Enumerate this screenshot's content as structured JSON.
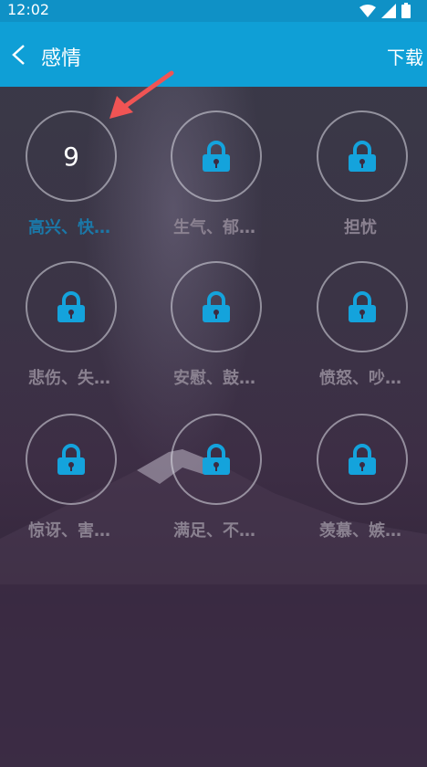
{
  "status_bar": {
    "time": "12:02"
  },
  "app_bar": {
    "title": "感情",
    "action": "下载"
  },
  "items": [
    {
      "label": "高兴、快…",
      "count": "9",
      "locked": false,
      "active": true
    },
    {
      "label": "生气、郁…",
      "locked": true
    },
    {
      "label": "担忧",
      "locked": true
    },
    {
      "label": "悲伤、失…",
      "locked": true
    },
    {
      "label": "安慰、鼓…",
      "locked": true
    },
    {
      "label": "愤怒、吵…",
      "locked": true
    },
    {
      "label": "惊讶、害…",
      "locked": true
    },
    {
      "label": "满足、不…",
      "locked": true
    },
    {
      "label": "羡慕、嫉…",
      "locked": true
    }
  ],
  "colors": {
    "accent": "#0f9fd6",
    "lock": "#14a3dc",
    "arrow": "#f05454"
  }
}
